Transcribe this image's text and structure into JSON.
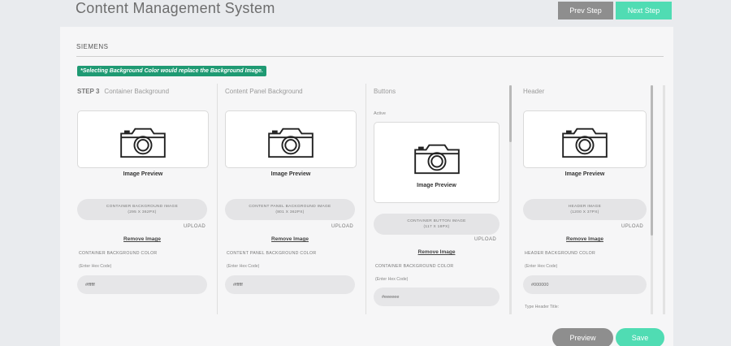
{
  "app": {
    "title": "Content Management System"
  },
  "nav": {
    "prev_label": "Prev Step",
    "next_label": "Next Step"
  },
  "brand": "SIEMENS",
  "notice": "*Selecting Background Color would replace the Background Image.",
  "step_label": "STEP 3",
  "columns": [
    {
      "title": "Container Background",
      "image_caption": "Image Preview",
      "file_label": "CONTAINER BACKGROUND IMAGE",
      "file_dims": "(295 X 362PX)",
      "upload": "UPLOAD",
      "remove": "Remove Image",
      "color_label": "CONTAINER BACKGROUND COLOR",
      "hint": "(Enter Hex Code)",
      "color_value": "#ffffff"
    },
    {
      "title": "Content Panel Background",
      "image_caption": "Image Preview",
      "file_label": "CONTENT PANEL BACKGROUND IMAGE",
      "file_dims": "(801 X 362PX)",
      "upload": "UPLOAD",
      "remove": "Remove Image",
      "color_label": "CONTENT PANEL BACKGROUND COLOR",
      "hint": "(Enter Hex Code)",
      "color_value": "#ffffff"
    },
    {
      "title": "Buttons",
      "sub_label": "Active",
      "image_caption": "Image Preview",
      "file_label": "CONTAINER BUTTON IMAGE",
      "file_dims": "(117 X 18PX)",
      "upload": "UPLOAD",
      "remove": "Remove Image",
      "color_label": "CONTAINER BACKGROUND COLOR",
      "hint": "(Enter Hex Code)",
      "color_value": "#eeeeee"
    },
    {
      "title": "Header",
      "image_caption": "Image Preview",
      "file_label": "HEADER IMAGE",
      "file_dims": "(1200 X 37PX)",
      "upload": "UPLOAD",
      "remove": "Remove Image",
      "color_label": "HEADER BACKGROUND COLOR",
      "hint": "(Enter Hex Code)",
      "color_value": "#000000",
      "extra_label": "Type Header Title:"
    }
  ],
  "actions": {
    "preview_label": "Preview",
    "save_label": "Save"
  },
  "colors": {
    "accent": "#50dcb3",
    "notice_bg": "#1f9a73",
    "neutral_button": "#8e8e8e"
  }
}
